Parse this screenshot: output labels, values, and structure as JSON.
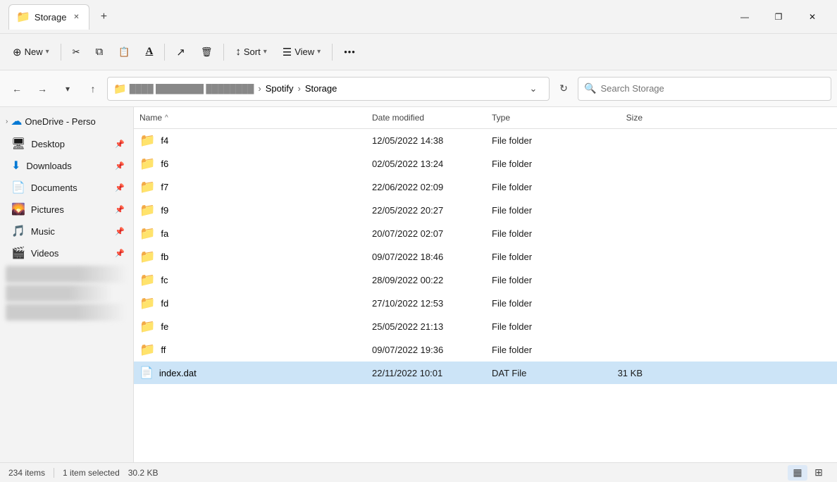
{
  "titlebar": {
    "tab_icon": "📁",
    "tab_title": "Storage",
    "tab_close": "✕",
    "tab_new": "+",
    "win_minimize": "—",
    "win_maximize": "❐",
    "win_close": "✕"
  },
  "toolbar": {
    "new_label": "New",
    "new_icon": "⊕",
    "cut_icon": "✂",
    "copy_icon": "⧉",
    "paste_icon": "📋",
    "rename_icon": "Ａ",
    "share_icon": "↗",
    "delete_icon": "🗑",
    "sort_label": "Sort",
    "sort_icon": "↕",
    "view_label": "View",
    "view_icon": "☰",
    "more_icon": "..."
  },
  "addressbar": {
    "back_icon": "←",
    "forward_icon": "→",
    "recent_icon": "⌄",
    "up_icon": "↑",
    "breadcrumb_folder_icon": "📁",
    "breadcrumb_spotify": "Spotify",
    "breadcrumb_storage": "Storage",
    "chevron_down": "⌄",
    "refresh_icon": "↻",
    "search_placeholder": "Search Storage",
    "search_icon": "🔍"
  },
  "sidebar": {
    "onedrive_label": "OneDrive - Perso",
    "onedrive_icon": "☁",
    "onedrive_chevron": "›",
    "desktop_label": "Desktop",
    "desktop_icon": "🖥",
    "desktop_pin": "📌",
    "downloads_label": "Downloads",
    "downloads_icon": "⬇",
    "downloads_pin": "📌",
    "documents_label": "Documents",
    "documents_icon": "📄",
    "documents_pin": "📌",
    "pictures_label": "Pictures",
    "pictures_icon": "🌄",
    "pictures_pin": "📌",
    "music_label": "Music",
    "music_icon": "🎵",
    "music_pin": "📌",
    "videos_label": "Videos",
    "videos_icon": "🎬",
    "videos_pin": "📌"
  },
  "file_list": {
    "col_name": "Name",
    "col_date": "Date modified",
    "col_type": "Type",
    "col_size": "Size",
    "sort_arrow": "^",
    "folders": [
      {
        "name": "f4",
        "date": "12/05/2022 14:38",
        "type": "File folder",
        "size": ""
      },
      {
        "name": "f6",
        "date": "02/05/2022 13:24",
        "type": "File folder",
        "size": ""
      },
      {
        "name": "f7",
        "date": "22/06/2022 02:09",
        "type": "File folder",
        "size": ""
      },
      {
        "name": "f9",
        "date": "22/05/2022 20:27",
        "type": "File folder",
        "size": ""
      },
      {
        "name": "fa",
        "date": "20/07/2022 02:07",
        "type": "File folder",
        "size": ""
      },
      {
        "name": "fb",
        "date": "09/07/2022 18:46",
        "type": "File folder",
        "size": ""
      },
      {
        "name": "fc",
        "date": "28/09/2022 00:22",
        "type": "File folder",
        "size": ""
      },
      {
        "name": "fd",
        "date": "27/10/2022 12:53",
        "type": "File folder",
        "size": ""
      },
      {
        "name": "fe",
        "date": "25/05/2022 21:13",
        "type": "File folder",
        "size": ""
      },
      {
        "name": "ff",
        "date": "09/07/2022 19:36",
        "type": "File folder",
        "size": ""
      }
    ],
    "files": [
      {
        "name": "index.dat",
        "date": "22/11/2022 10:01",
        "type": "DAT File",
        "size": "31 KB",
        "selected": true
      }
    ]
  },
  "statusbar": {
    "item_count": "234 items",
    "selected": "1 item selected",
    "selected_size": "30.2 KB",
    "view_details_icon": "▦",
    "view_large_icon": "⊞"
  }
}
